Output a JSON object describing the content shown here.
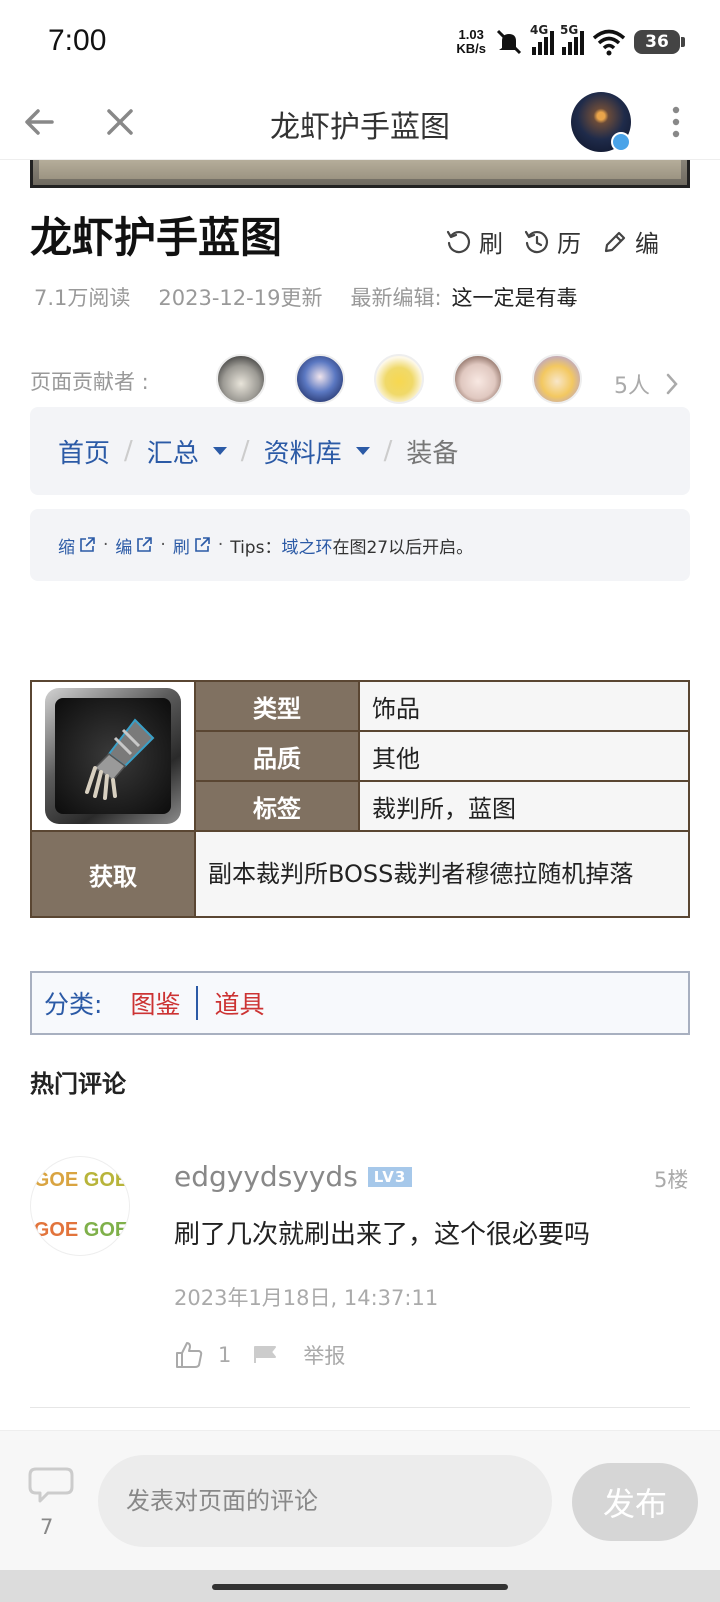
{
  "status_bar": {
    "time": "7:00",
    "net_speed_value": "1.03",
    "net_speed_unit": "KB/s",
    "signal_4g": "4G",
    "signal_5g": "5G",
    "battery": "36"
  },
  "nav": {
    "title": "龙虾护手蓝图"
  },
  "page": {
    "heading": "龙虾护手蓝图",
    "actions": {
      "refresh": "刷",
      "history": "历",
      "edit": "编"
    },
    "meta": {
      "reads": "7.1万阅读",
      "updated": "2023-12-19更新",
      "last_editor_label": "最新编辑:",
      "last_editor": "这一定是有毒"
    }
  },
  "contributors": {
    "label": "页面贡献者 :",
    "count": "5人"
  },
  "breadcrumb": {
    "items": [
      "首页",
      "汇总",
      "资料库",
      "装备"
    ]
  },
  "tools": {
    "collapse": "缩",
    "edit": "编",
    "refresh": "刷",
    "tips_prefix": "Tips：",
    "tips_link": "域之环",
    "tips_suffix": "在图27以后开启。"
  },
  "infobox": {
    "rows": [
      {
        "label": "类型",
        "value": "饰品"
      },
      {
        "label": "品质",
        "value": "其他"
      },
      {
        "label": "标签",
        "value": "裁判所，蓝图"
      }
    ],
    "obtain_label": "获取",
    "obtain_value": "副本裁判所BOSS裁判者穆德拉随机掉落"
  },
  "category": {
    "label": "分类:",
    "links": [
      "图鉴",
      "道具"
    ]
  },
  "comments": {
    "section_title": "热门评论",
    "items": [
      {
        "user": "edgyydsyyds",
        "level": "LV3",
        "floor": "5楼",
        "text": "刷了几次就刷出来了，这个很必要吗",
        "time": "2023年1月18日, 14:37:11",
        "likes": "1",
        "report": "举报",
        "avatar_text": [
          "GOE",
          "GOE",
          "GOE",
          "GOE"
        ]
      }
    ]
  },
  "bottom_bar": {
    "comment_count": "7",
    "input_placeholder": "发表对页面的评论",
    "publish": "发布"
  }
}
